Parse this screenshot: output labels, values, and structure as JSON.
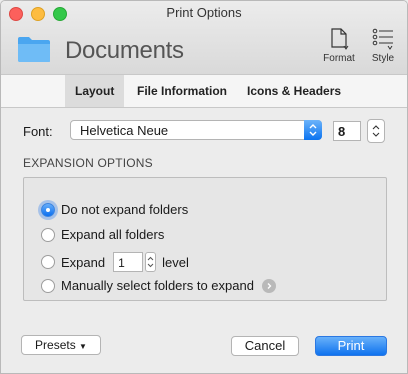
{
  "window": {
    "title": "Print Options"
  },
  "toolbar": {
    "document_title": "Documents",
    "format_label": "Format",
    "style_label": "Style"
  },
  "tabs": [
    {
      "label": "Layout",
      "active": true
    },
    {
      "label": "File Information",
      "active": false
    },
    {
      "label": "Icons & Headers",
      "active": false
    }
  ],
  "font": {
    "label": "Font:",
    "family": "Helvetica Neue",
    "size": "8"
  },
  "expansion": {
    "section_label": "EXPANSION OPTIONS",
    "options": [
      {
        "label": "Do not expand folders",
        "selected": true
      },
      {
        "label": "Expand all folders",
        "selected": false
      },
      {
        "label": "Expand",
        "selected": false,
        "level_value": "1",
        "suffix": "level"
      },
      {
        "label": "Manually select folders to expand",
        "selected": false
      }
    ]
  },
  "buttons": {
    "presets": "Presets",
    "cancel": "Cancel",
    "print": "Print"
  },
  "colors": {
    "accent": "#0f72ee",
    "window_bg": "#ececec"
  }
}
